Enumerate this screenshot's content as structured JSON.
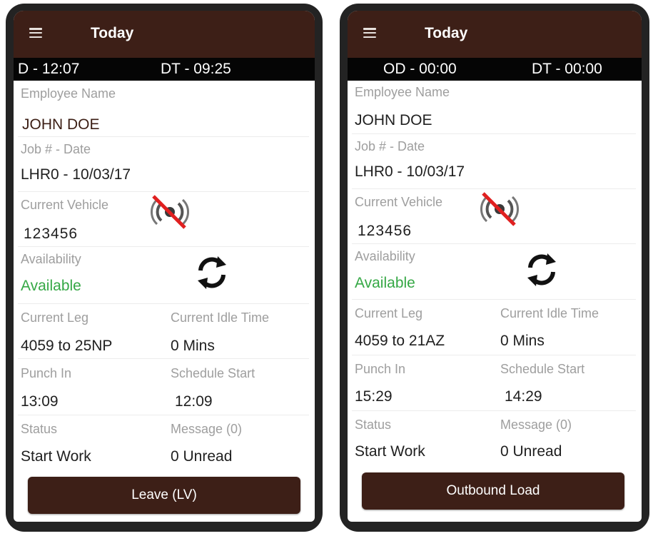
{
  "phones": [
    {
      "header_title": "Today",
      "od": "D - 12:07",
      "dt": "DT - 09:25",
      "employee_label": "Employee Name",
      "employee_value": "JOHN DOE",
      "job_label": "Job # - Date",
      "job_value": "LHR0 - 10/03/17",
      "vehicle_label": "Current Vehicle",
      "vehicle_value": "123456",
      "availability_label": "Availability",
      "availability_value": "Available",
      "leg_label": "Current Leg",
      "leg_value": "4059 to 25NP",
      "idle_label": "Current Idle Time",
      "idle_value": "0 Mins",
      "punch_label": "Punch In",
      "punch_value": "13:09",
      "schedule_label": "Schedule Start",
      "schedule_value": "12:09",
      "status_label": "Status",
      "status_value": "Start Work",
      "message_label": "Message (0)",
      "message_value": "0 Unread",
      "action_label": "Leave (LV)"
    },
    {
      "header_title": "Today",
      "od": "OD - 00:00",
      "dt": "DT - 00:00",
      "employee_label": "Employee Name",
      "employee_value": "JOHN DOE",
      "job_label": "Job # - Date",
      "job_value": "LHR0 - 10/03/17",
      "vehicle_label": "Current Vehicle",
      "vehicle_value": "123456",
      "availability_label": "Availability",
      "availability_value": "Available",
      "leg_label": "Current Leg",
      "leg_value": "4059 to 21AZ",
      "idle_label": "Current Idle Time",
      "idle_value": "0 Mins",
      "punch_label": "Punch In",
      "punch_value": "15:29",
      "schedule_label": "Schedule Start",
      "schedule_value": "14:29",
      "status_label": "Status",
      "status_value": "Start Work",
      "message_label": "Message (0)",
      "message_value": "0 Unread",
      "action_label": "Outbound Load"
    }
  ],
  "colors": {
    "header_bg": "#3d1f17",
    "timebar_bg": "#050505",
    "available_green": "#35a845",
    "signal_slash_red": "#e02020"
  },
  "icons": {
    "menu": "hamburger-icon",
    "signal": "no-signal-icon",
    "sync": "sync-icon"
  }
}
